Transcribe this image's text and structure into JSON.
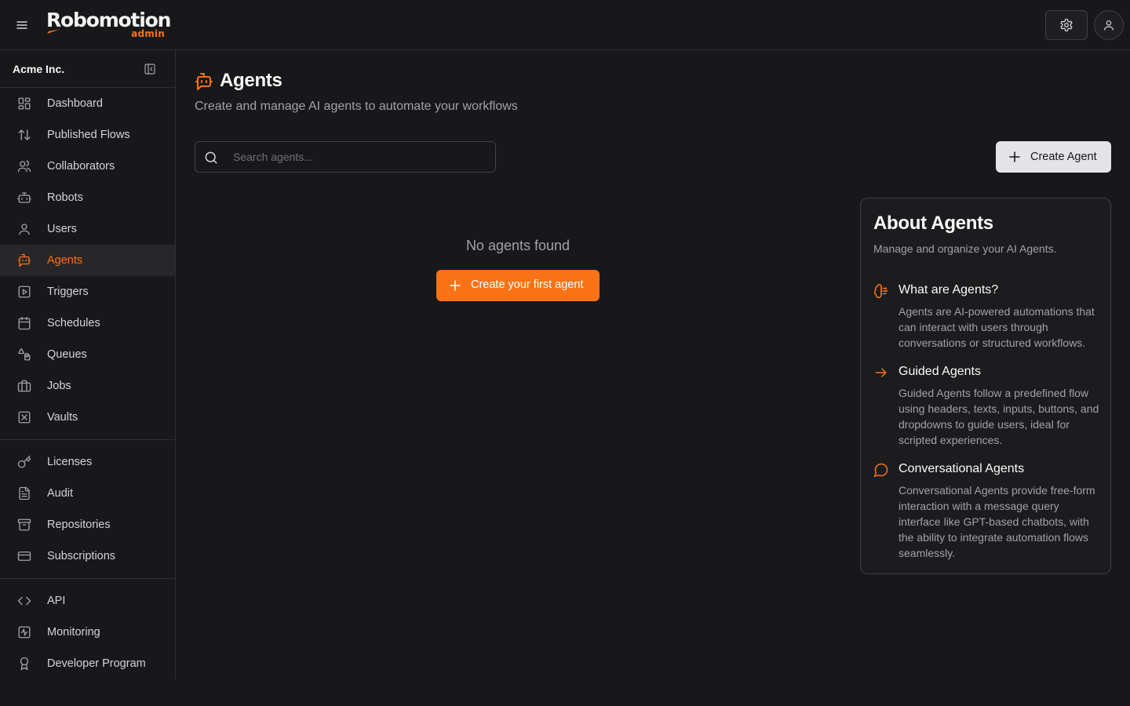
{
  "header": {
    "logo_text": "Robomotion",
    "logo_sub": "admin"
  },
  "sidebar": {
    "org_name": "Acme Inc.",
    "groups": [
      [
        {
          "label": "Dashboard",
          "icon": "dashboard-icon"
        },
        {
          "label": "Published Flows",
          "icon": "arrows-up-down-icon"
        },
        {
          "label": "Collaborators",
          "icon": "users-icon"
        },
        {
          "label": "Robots",
          "icon": "robot-icon"
        },
        {
          "label": "Users",
          "icon": "user-icon"
        },
        {
          "label": "Agents",
          "icon": "bot-message-icon",
          "active": true
        },
        {
          "label": "Triggers",
          "icon": "play-square-icon"
        },
        {
          "label": "Schedules",
          "icon": "calendar-icon"
        },
        {
          "label": "Queues",
          "icon": "shapes-icon"
        },
        {
          "label": "Jobs",
          "icon": "briefcase-icon"
        },
        {
          "label": "Vaults",
          "icon": "vault-icon"
        }
      ],
      [
        {
          "label": "Licenses",
          "icon": "key-icon"
        },
        {
          "label": "Audit",
          "icon": "file-text-icon"
        },
        {
          "label": "Repositories",
          "icon": "archive-icon"
        },
        {
          "label": "Subscriptions",
          "icon": "credit-card-icon"
        }
      ],
      [
        {
          "label": "API",
          "icon": "code-icon"
        },
        {
          "label": "Monitoring",
          "icon": "activity-icon"
        },
        {
          "label": "Developer Program",
          "icon": "award-icon"
        }
      ]
    ]
  },
  "main": {
    "title": "Agents",
    "subtitle": "Create and manage AI agents to automate your workflows",
    "search_placeholder": "Search agents...",
    "search_value": "",
    "create_label": "Create Agent",
    "empty_text": "No agents found",
    "first_agent_label": "Create your first agent"
  },
  "about": {
    "title": "About Agents",
    "subtitle": "Manage and organize your AI Agents.",
    "features": [
      {
        "title": "What are Agents?",
        "icon": "brain-icon",
        "desc": "Agents are AI-powered automations that can interact with users through conversations or structured workflows."
      },
      {
        "title": "Guided Agents",
        "icon": "arrow-right-icon",
        "desc": "Guided Agents follow a predefined flow using headers, texts, inputs, buttons, and dropdowns to guide users, ideal for scripted experiences."
      },
      {
        "title": "Conversational Agents",
        "icon": "message-circle-icon",
        "desc": "Conversational Agents provide free-form interaction with a message query interface like GPT-based chatbots, with the ability to integrate automation flows seamlessly."
      }
    ]
  },
  "colors": {
    "accent": "#f97316",
    "background": "#18181b",
    "active_bg": "#27272a"
  }
}
